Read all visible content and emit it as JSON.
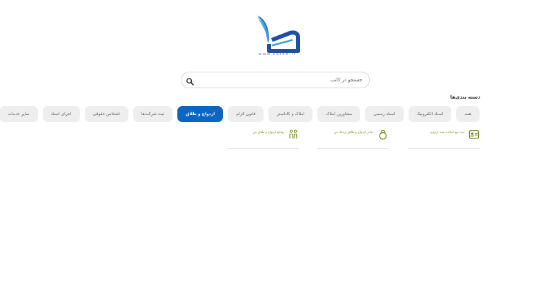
{
  "header": {
    "logo_url_text": "www.kateb.ir",
    "logo_colors": {
      "primary": "#1e4fa3",
      "secondary": "#3aa0e0"
    }
  },
  "search": {
    "placeholder": "جستجو در کاتب",
    "value": ""
  },
  "categories": {
    "title": "دسته بندی‌ها",
    "items": [
      {
        "label": "همه",
        "active": false
      },
      {
        "label": "اسناد الکترونیک",
        "active": false
      },
      {
        "label": "اسناد رسمی",
        "active": false
      },
      {
        "label": "مشاورین املاک",
        "active": false
      },
      {
        "label": "املاک و کاداستر",
        "active": false
      },
      {
        "label": "قانون الزام",
        "active": false
      },
      {
        "label": "ازدواج و طلاق",
        "active": true
      },
      {
        "label": "ثبت شرکت‌ها",
        "active": false
      },
      {
        "label": "اشخاص حقوقی",
        "active": false
      },
      {
        "label": "اجرای اسناد",
        "active": false
      },
      {
        "label": "سایر خدمات",
        "active": false
      }
    ],
    "colors": {
      "active": "#0b66c3",
      "inactive": "#eeeeee"
    }
  },
  "services": [
    {
      "label": "ثبت بیع اصالت سند ازدواج",
      "icon": "id-card-icon"
    },
    {
      "label": "دفاتر ازدواج و طلاق نزدیک من",
      "icon": "ring-icon"
    },
    {
      "label": "وقایع ازدواج و طلاق من",
      "icon": "couple-icon"
    }
  ],
  "accent_color": "#7a8c1a"
}
